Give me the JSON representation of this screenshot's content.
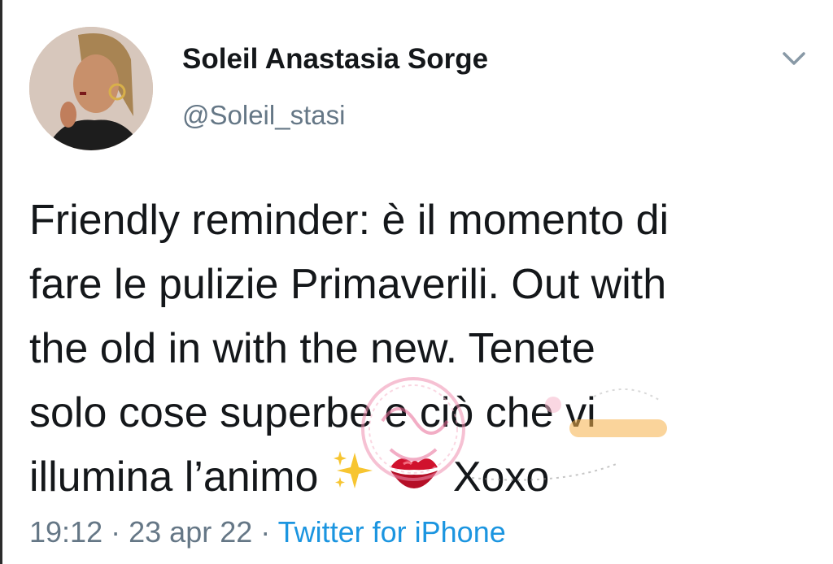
{
  "user": {
    "display_name": "Soleil Anastasia Sorge",
    "handle": "@Soleil_stasi"
  },
  "tweet": {
    "lines": [
      "Friendly reminder: è il momento di",
      "fare le pulizie Primaverili. Out with",
      "the old in with the new. Tenete",
      "solo cose superbe e ciò che vi",
      "illumina l’animo"
    ],
    "trailing": "Xoxo",
    "emojis": [
      "sparkles-icon",
      "kiss-mark-icon"
    ]
  },
  "meta": {
    "time": "19:12",
    "separator": "·",
    "date": "23 apr 22",
    "source": "Twitter for iPhone"
  },
  "colors": {
    "text": "#14171a",
    "secondary": "#657786",
    "link": "#1b95e0"
  }
}
